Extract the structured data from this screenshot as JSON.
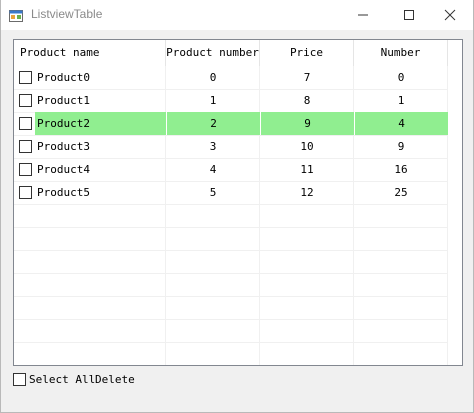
{
  "window": {
    "title": "ListviewTable"
  },
  "columns": [
    "Product name",
    "Product number",
    "Price",
    "Number"
  ],
  "rows": [
    {
      "name": "Product0",
      "number": "0",
      "price": "7",
      "count": "0",
      "selected": false
    },
    {
      "name": "Product1",
      "number": "1",
      "price": "8",
      "count": "1",
      "selected": false
    },
    {
      "name": "Product2",
      "number": "2",
      "price": "9",
      "count": "4",
      "selected": true
    },
    {
      "name": "Product3",
      "number": "3",
      "price": "10",
      "count": "9",
      "selected": false
    },
    {
      "name": "Product4",
      "number": "4",
      "price": "11",
      "count": "16",
      "selected": false
    },
    {
      "name": "Product5",
      "number": "5",
      "price": "12",
      "count": "25",
      "selected": false
    }
  ],
  "footer": {
    "select_all_label": "Select All",
    "delete_label": "Delete"
  },
  "colors": {
    "selection": "#90ee90",
    "border": "#828790"
  },
  "icons": {
    "app": "app-window-icon",
    "minimize": "minimize-icon",
    "maximize": "maximize-icon",
    "close": "close-icon"
  }
}
